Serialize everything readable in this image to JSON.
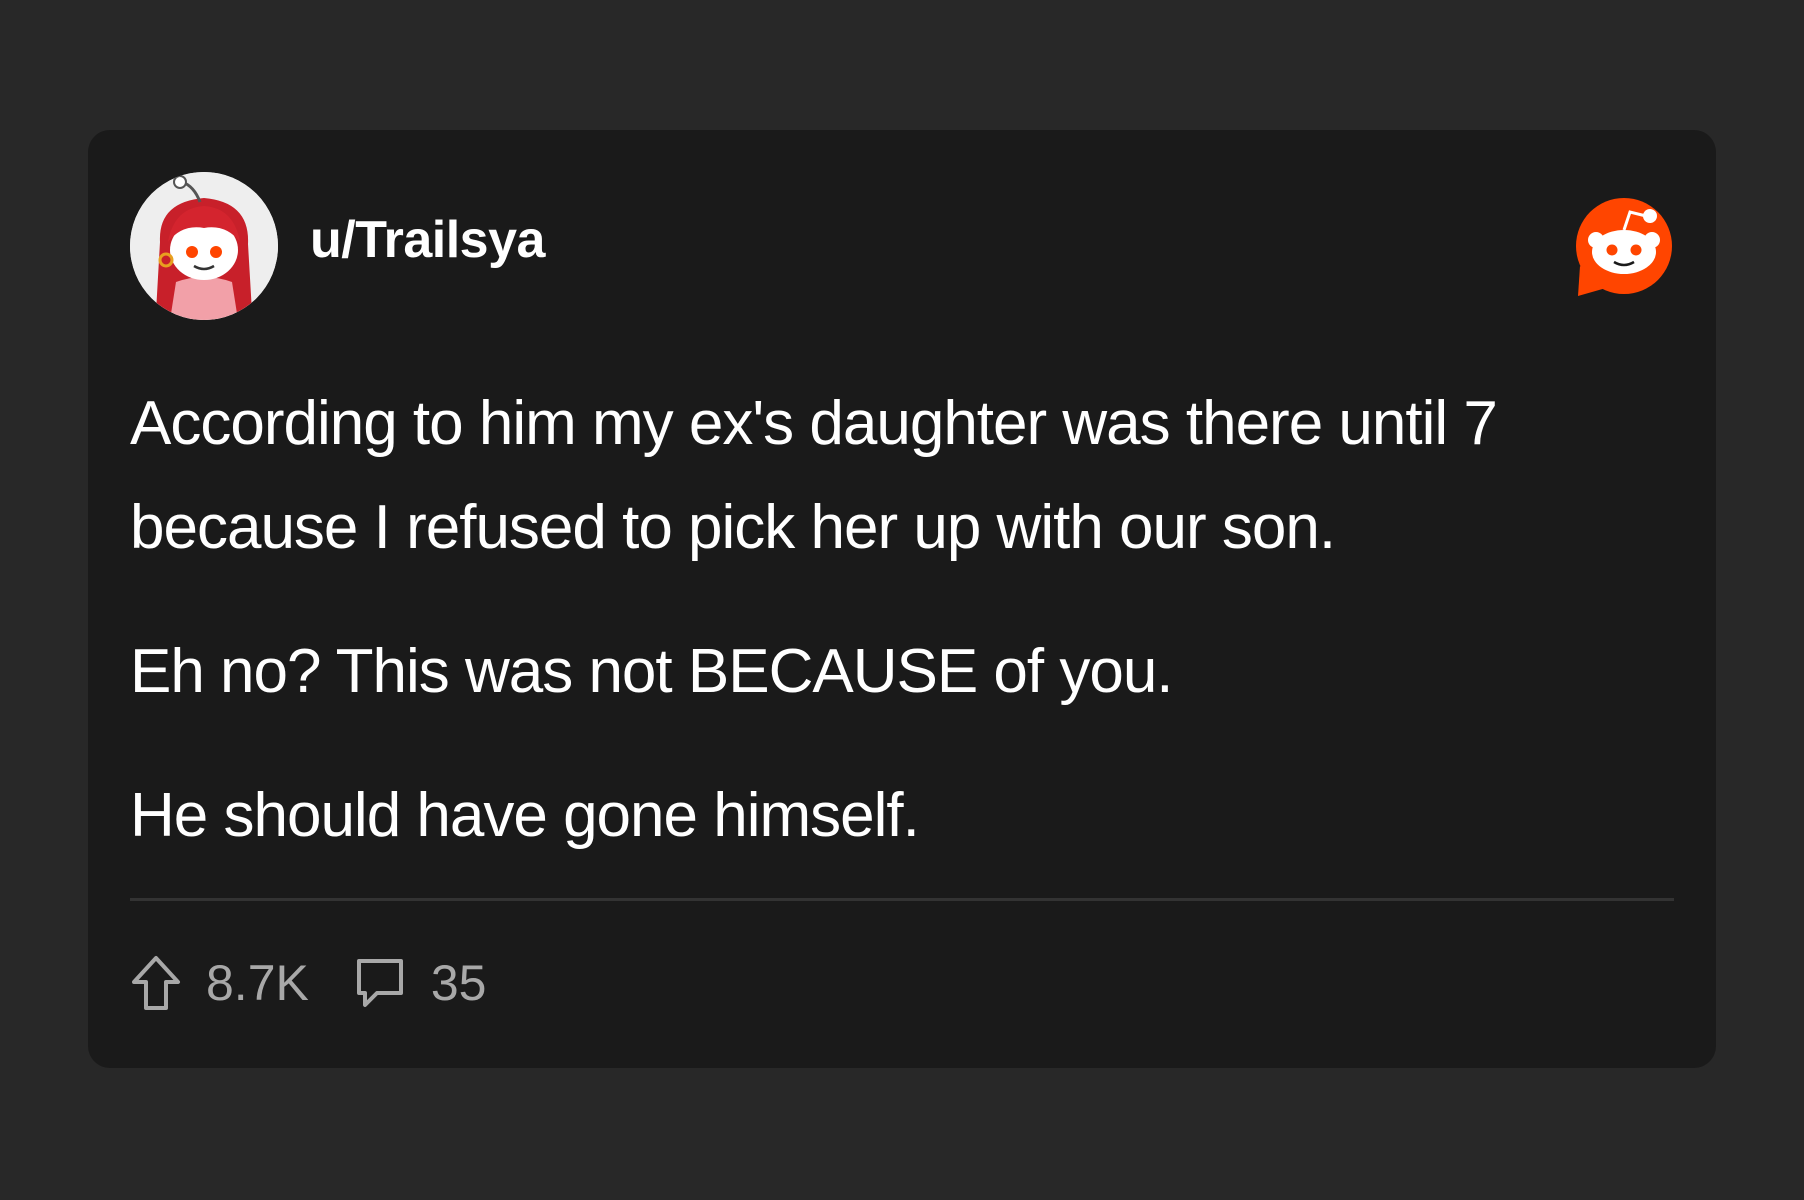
{
  "post": {
    "username": "u/Trailsya",
    "paragraphs": [
      "According to him my ex's daughter was there until 7 because I refused to pick her up with our son.",
      "Eh no? This was not BECAUSE of you.",
      "He should have gone himself."
    ],
    "upvotes": "8.7K",
    "comments": "35"
  },
  "icons": {
    "avatar": "avatar-image",
    "logo": "reddit-logo-icon",
    "upvote": "upvote-arrow-icon",
    "comment": "comment-bubble-icon"
  },
  "colors": {
    "background": "#282828",
    "card": "#1a1a1a",
    "reddit_orange": "#ff4500",
    "text": "#ffffff",
    "muted": "#a8a8a8"
  }
}
